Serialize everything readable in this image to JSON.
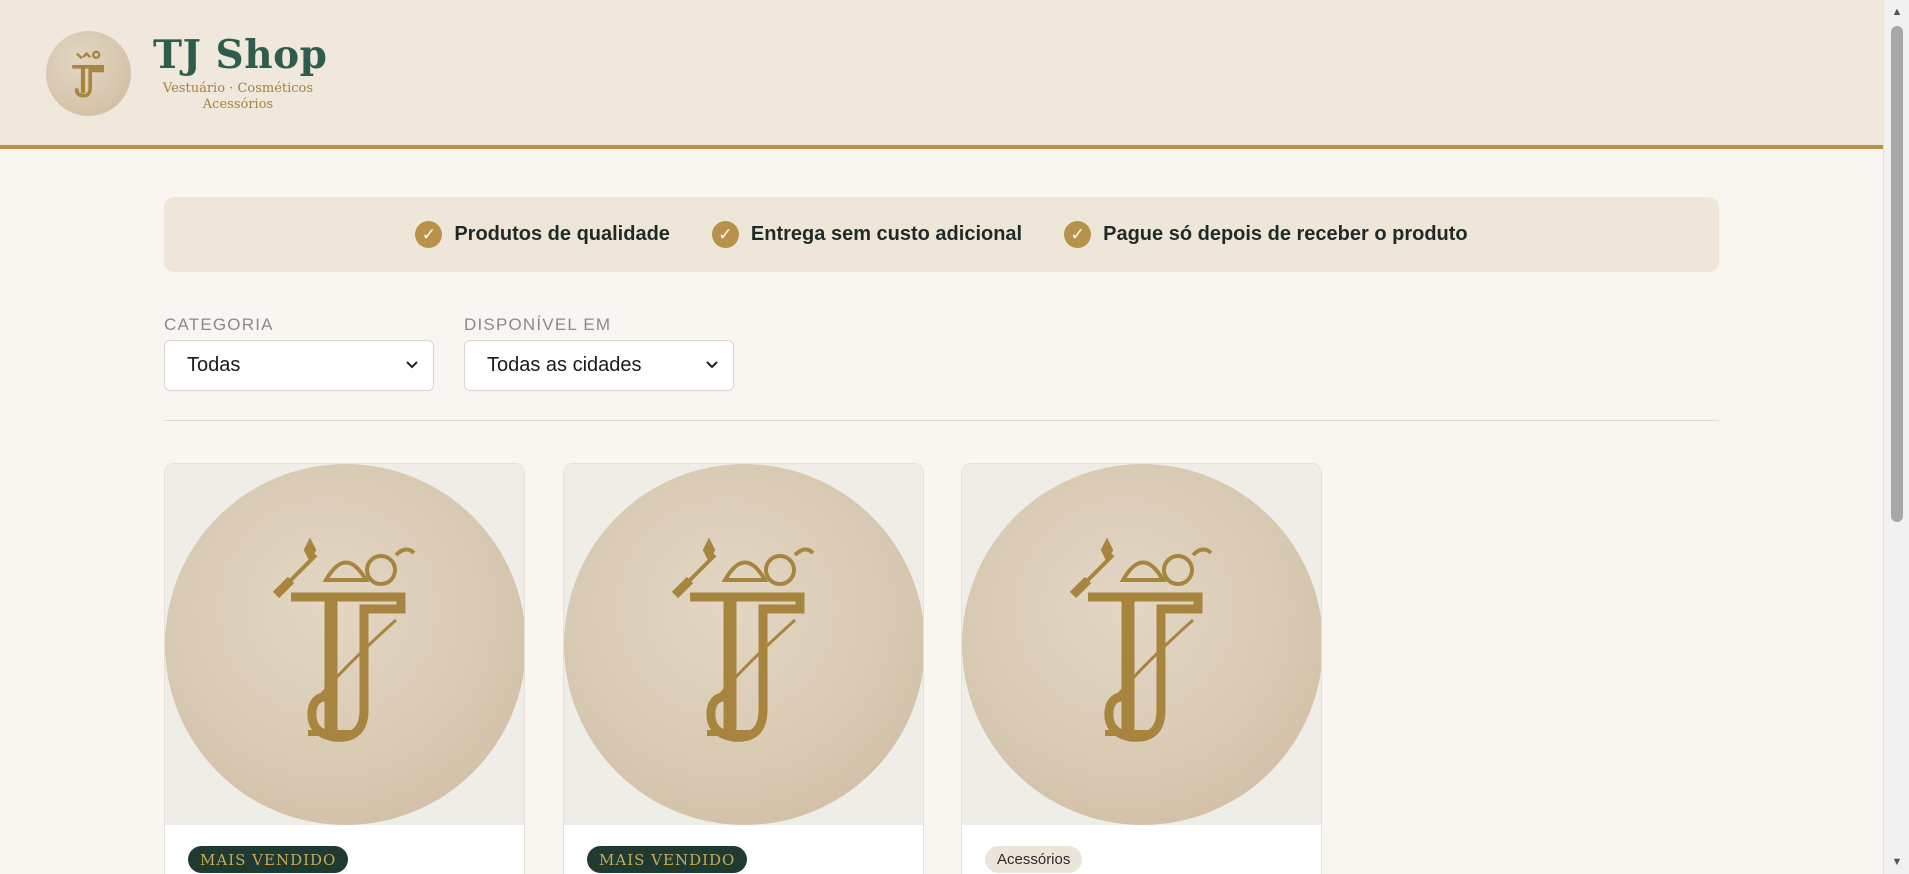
{
  "header": {
    "brand_name": "TJ Shop",
    "tagline": "Vestuário · Cosméticos\nAcessórios",
    "logo_monogram": "TJ"
  },
  "benefits": [
    {
      "icon": "check-icon",
      "label": "Produtos de qualidade"
    },
    {
      "icon": "check-icon",
      "label": "Entrega sem custo adicional"
    },
    {
      "icon": "check-icon",
      "label": "Pague só depois de receber o produto"
    }
  ],
  "filters": {
    "category": {
      "label": "CATEGORIA",
      "selected": "Todas"
    },
    "city": {
      "label": "DISPONÍVEL EM",
      "selected": "Todas as cidades"
    }
  },
  "products": [
    {
      "badge": "MAIS VENDIDO",
      "badge_style": "dark",
      "image_monogram": "TJ"
    },
    {
      "badge": "MAIS VENDIDO",
      "badge_style": "dark",
      "image_monogram": "TJ"
    },
    {
      "badge": "Acessórios",
      "badge_style": "light",
      "image_monogram": "TJ"
    }
  ],
  "colors": {
    "accent_gold": "#b8914a",
    "brand_green": "#2e5d4e",
    "header_bg": "#f0e8dc",
    "page_bg": "#f9f6f1"
  }
}
